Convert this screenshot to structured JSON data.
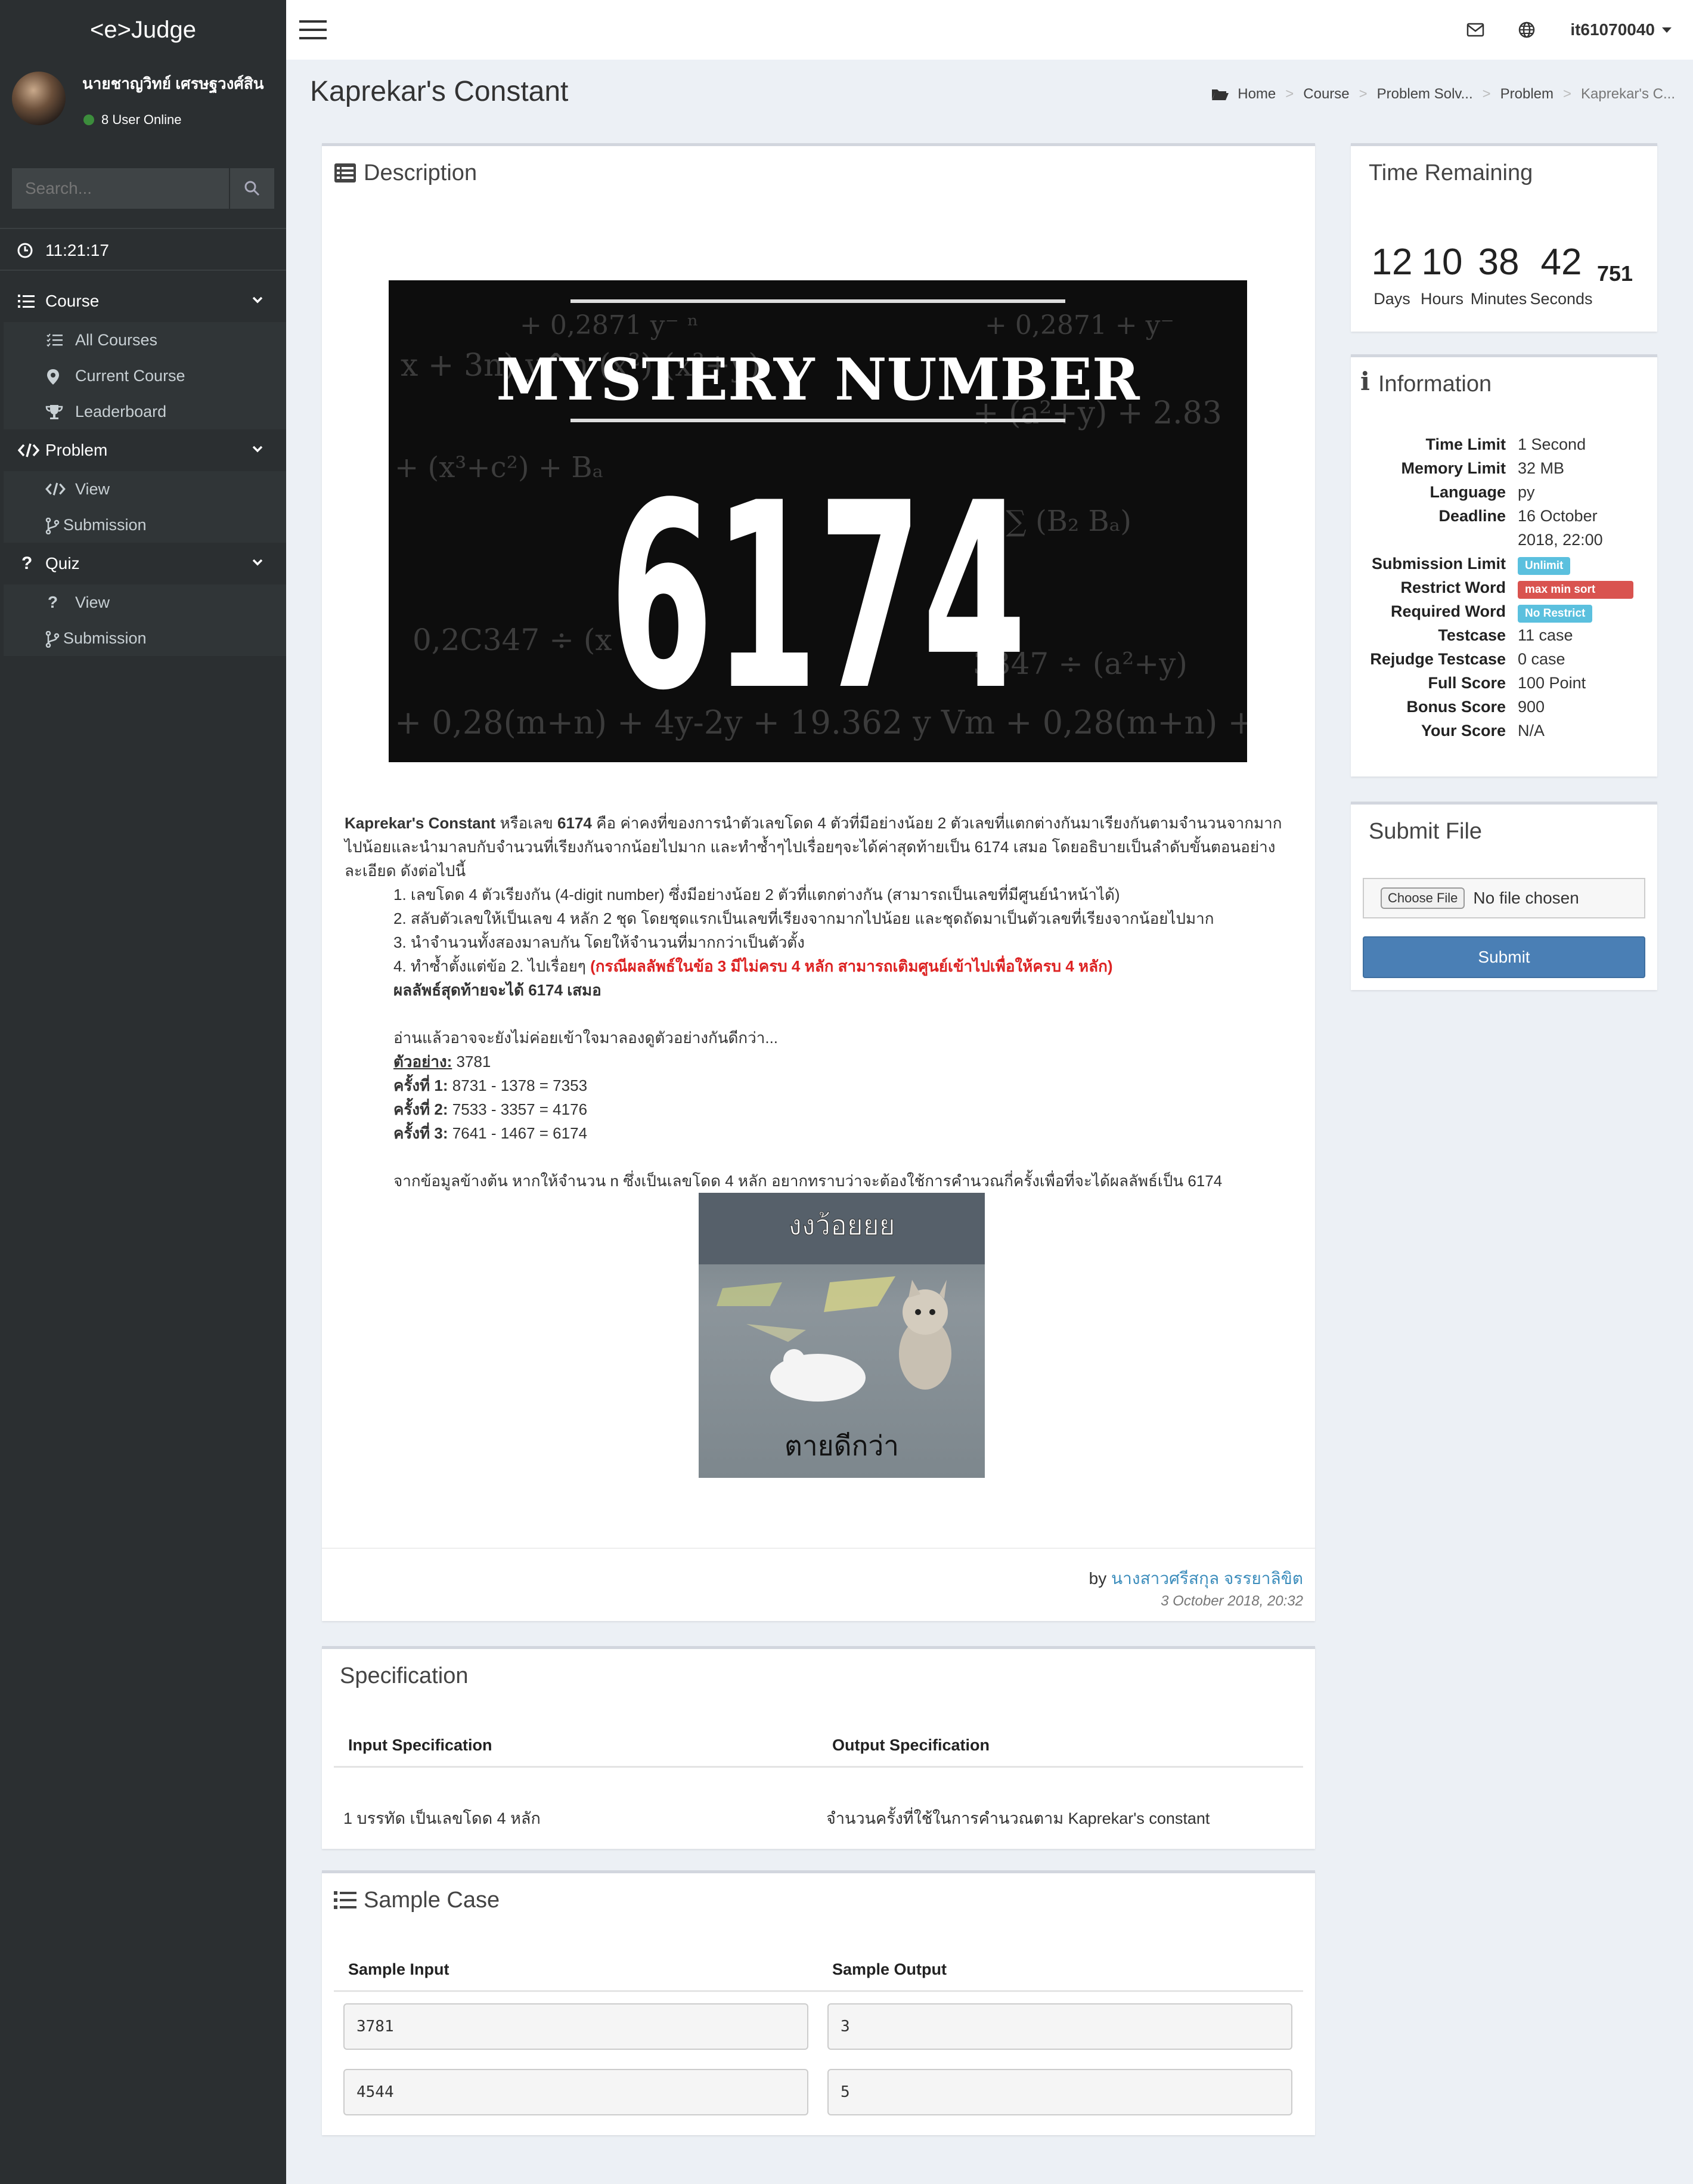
{
  "app": {
    "logo": "<e>Judge"
  },
  "user": {
    "name": "นายชาญวิทย์ เศรษฐวงศ์สิน",
    "online": "8 User Online",
    "account": "it61070040"
  },
  "search": {
    "placeholder": "Search..."
  },
  "clock": {
    "time": "11:21:17"
  },
  "menu": {
    "course": {
      "label": "Course",
      "items": [
        "All Courses",
        "Current Course",
        "Leaderboard"
      ]
    },
    "problem": {
      "label": "Problem",
      "items": [
        "View",
        "Submission"
      ]
    },
    "quiz": {
      "label": "Quiz",
      "items": [
        "View",
        "Submission"
      ]
    }
  },
  "page": {
    "title": "Kaprekar's Constant"
  },
  "breadcrumb": [
    "Home",
    "Course",
    "Problem Solv...",
    "Problem",
    "Kaprekar's C..."
  ],
  "description": {
    "title": "Description",
    "banner_title": "MYSTERY NUMBER",
    "banner_number": "6174",
    "intro_bold": "Kaprekar's Constant",
    "intro_1": " หรือเลข ",
    "intro_num": "6174",
    "intro_2": " คือ ค่าคงที่ของการนำตัวเลขโดด 4 ตัวที่มีอย่างน้อย 2 ตัวเลขที่แตกต่างกันมาเรียงกันตามจำนวนจากมากไปน้อยและนำมาลบกับจำนวนที่เรียงกันจากน้อยไปมาก และทำซ้ำๆไปเรื่อยๆจะได้ค่าสุดท้ายเป็น 6174 เสมอ โดยอธิบายเป็นลำดับขั้นตอนอย่างละเอียด ดังต่อไปนี้",
    "steps": [
      "1. เลขโดด 4 ตัวเรียงกัน (4-digit number) ซึ่งมีอย่างน้อย 2 ตัวที่แตกต่างกัน (สามารถเป็นเลขที่มีศูนย์นำหน้าได้)",
      "2. สลับตัวเลขให้เป็นเลข 4 หลัก 2 ชุด โดยชุดแรกเป็นเลขที่เรียงจากมากไปน้อย และชุดถัดมาเป็นตัวเลขที่เรียงจากน้อยไปมาก",
      "3. นำจำนวนทั้งสองมาลบกัน โดยให้จำนวนที่มากกว่าเป็นตัวตั้ง"
    ],
    "step4": "4. ทำซ้ำตั้งแต่ข้อ 2. ไปเรื่อยๆ ",
    "step4_note": "(กรณีผลลัพธ์ในข้อ 3 มีไม่ครบ 4 หลัก สามารถเติมศูนย์เข้าไปเพื่อให้ครบ 4 หลัก)",
    "result": "ผลลัพธ์สุดท้ายจะได้ 6174 เสมอ",
    "read": "อ่านแล้วอาจจะยังไม่ค่อยเข้าใจมาลองดูตัวอย่างกันดีกว่า...",
    "example_label": "ตัวอย่าง:",
    "example_value": " 3781",
    "rounds": [
      {
        "label": "ครั้งที่ 1:",
        "value": " 8731 - 1378 = 7353"
      },
      {
        "label": "ครั้งที่ 2:",
        "value": " 7533 - 3357 = 4176"
      },
      {
        "label": "ครั้งที่ 3:",
        "value": " 7641 - 1467 = 6174"
      }
    ],
    "question": "จากข้อมูลข้างต้น หากให้จำนวน n ซึ่งเป็นเลขโดด 4 หลัก อยากทราบว่าจะต้องใช้การคำนวณกี่ครั้งเพื่อที่จะได้ผลลัพธ์เป็น 6174",
    "meme_top": "งงว้อยยย",
    "meme_bottom": "ตายดีกว่า",
    "by": "by ",
    "author": "นางสาวศรีสกุล จรรยาลิขิต",
    "date": "3 October 2018, 20:32"
  },
  "time_remaining": {
    "title": "Time Remaining",
    "days": "12",
    "hours": "10",
    "minutes": "38",
    "seconds": "42",
    "ms": "751",
    "labels": [
      "Days",
      "Hours",
      "Minutes",
      "Seconds"
    ]
  },
  "information": {
    "title": "Information",
    "rows": [
      {
        "k": "Time Limit",
        "v": "1 Second"
      },
      {
        "k": "Memory Limit",
        "v": "32 MB"
      },
      {
        "k": "Language",
        "v": "py"
      },
      {
        "k": "Deadline",
        "v": "16 October 2018, 22:00"
      },
      {
        "k": "Submission Limit",
        "v": "Unlimit"
      },
      {
        "k": "Restrict Word",
        "v": "max min sort"
      },
      {
        "k": "Required Word",
        "v": "No Restrict"
      },
      {
        "k": "Testcase",
        "v": "11 case"
      },
      {
        "k": "Rejudge Testcase",
        "v": "0 case"
      },
      {
        "k": "Full Score",
        "v": "100 Point"
      },
      {
        "k": "Bonus Score",
        "v": "900"
      },
      {
        "k": "Your Score",
        "v": "N/A"
      }
    ],
    "colors": {
      "info": "#5bc0de",
      "danger": "#d9534f"
    }
  },
  "submit_file": {
    "title": "Submit File",
    "choose": "Choose File",
    "status": "No file chosen",
    "button": "Submit"
  },
  "specification": {
    "title": "Specification",
    "input_header": "Input Specification",
    "output_header": "Output Specification",
    "input": "1 บรรทัด เป็นเลขโดด 4 หลัก",
    "output": "จำนวนครั้งที่ใช้ในการคำนวณตาม Kaprekar's constant"
  },
  "sample": {
    "title": "Sample Case",
    "input_header": "Sample Input",
    "output_header": "Sample Output",
    "rows": [
      {
        "input": "3781",
        "output": "3"
      },
      {
        "input": "4544",
        "output": "5"
      }
    ]
  }
}
